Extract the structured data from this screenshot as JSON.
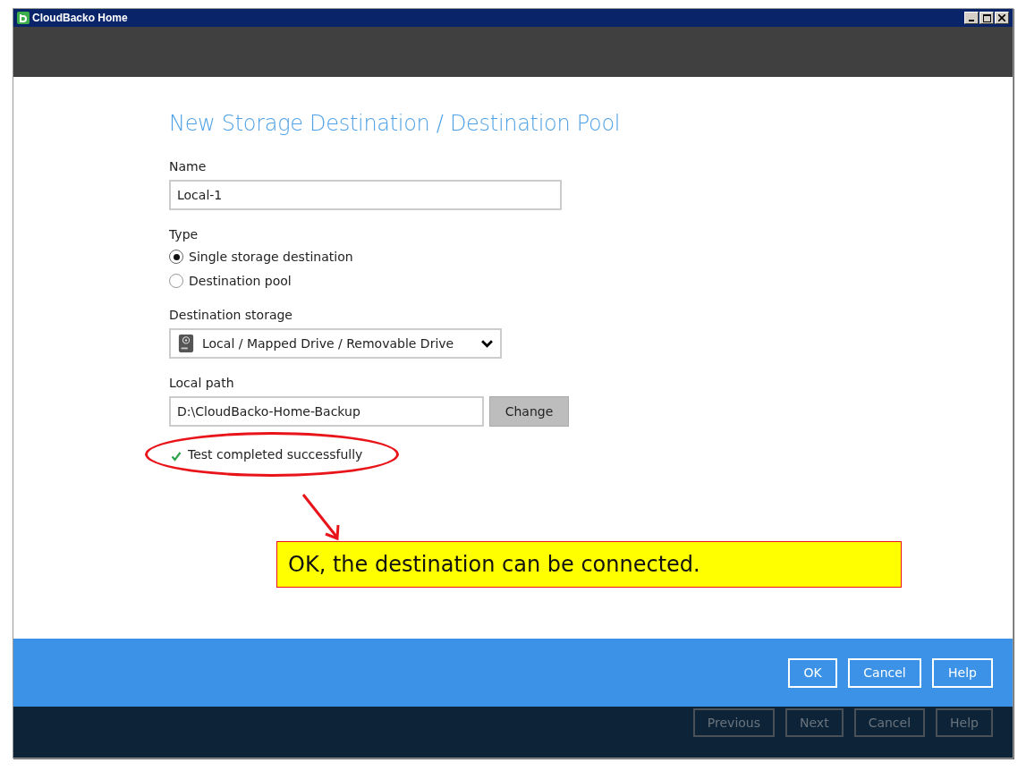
{
  "window": {
    "title": "CloudBacko Home"
  },
  "form": {
    "title": "New Storage Destination / Destination Pool",
    "name": {
      "label": "Name",
      "value": "Local-1"
    },
    "type": {
      "label": "Type",
      "options": [
        {
          "label": "Single storage destination",
          "selected": true
        },
        {
          "label": "Destination pool",
          "selected": false
        }
      ]
    },
    "destination_storage": {
      "label": "Destination storage",
      "value": "Local / Mapped Drive / Removable Drive"
    },
    "local_path": {
      "label": "Local path",
      "value": "D:\\CloudBacko-Home-Backup",
      "button": "Change"
    },
    "status": "Test completed successfully"
  },
  "dialog_buttons": [
    "OK",
    "Cancel",
    "Help"
  ],
  "wizard_buttons": [
    {
      "label": "Previous",
      "disabled": true
    },
    {
      "label": "Next",
      "disabled": true
    },
    {
      "label": "Cancel",
      "disabled": true
    },
    {
      "label": "Help",
      "disabled": true
    }
  ],
  "annotation": {
    "callout": "OK, the destination can be connected."
  }
}
